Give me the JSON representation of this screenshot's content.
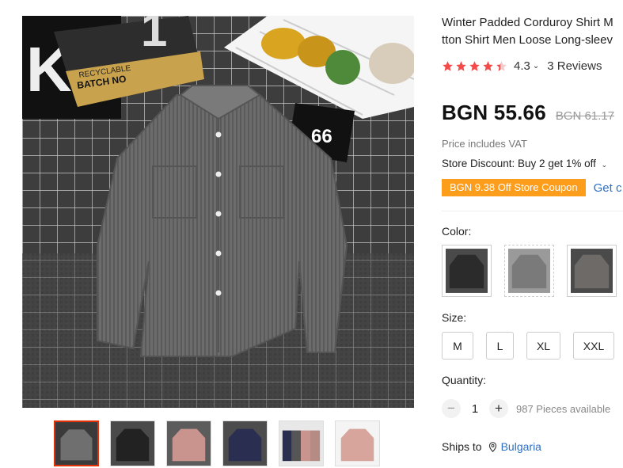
{
  "product": {
    "title_line1": "Winter Padded Corduroy Shirt M",
    "title_line2": "tton Shirt Men Loose Long-sleev",
    "rating": "4.3",
    "rating_stars": 4.3,
    "reviews": "3 Reviews"
  },
  "price": {
    "current": "BGN 55.66",
    "original": "BGN 61.17",
    "vat_note": "Price includes VAT"
  },
  "discount": {
    "store_discount": "Store Discount: Buy 2 get 1% off",
    "coupon": "BGN 9.38 Off Store Coupon",
    "get_coupon": "Get c"
  },
  "options": {
    "color_label": "Color:",
    "colors": [
      {
        "name": "black",
        "swatch": "#2b2b2b"
      },
      {
        "name": "gray",
        "swatch": "#7a7a7a"
      },
      {
        "name": "dark-gray",
        "swatch": "#5e5e5e"
      }
    ],
    "size_label": "Size:",
    "sizes": [
      "M",
      "L",
      "XL",
      "XXL"
    ],
    "quantity_label": "Quantity:",
    "quantity": "1",
    "minus": "−",
    "plus": "+",
    "available": "987 Pieces available"
  },
  "shipping": {
    "label": "Ships to",
    "country": "Bulgaria"
  },
  "gallery": {
    "thumbnails": [
      {
        "name": "gray",
        "color": "#6f6f6f",
        "bg": "#3a3a3a"
      },
      {
        "name": "black",
        "color": "#222222",
        "bg": "#4a4a4a"
      },
      {
        "name": "pink",
        "color": "#c9948e",
        "bg": "#5c5c5c"
      },
      {
        "name": "navy",
        "color": "#2a2f52",
        "bg": "#4c4c4c"
      },
      {
        "name": "multi",
        "color": "#b68b84",
        "bg": "#e8e8e8"
      },
      {
        "name": "pink-white",
        "color": "#d7a59c",
        "bg": "#f4f4f4"
      }
    ]
  },
  "image_text": {
    "sign_66": "66",
    "batch": "BATCH NO",
    "recyclable": "RECYCLABLE"
  },
  "colors": {
    "star": "#f44a4a",
    "coupon_bg": "#fd9d1c",
    "link": "#2e6fc4",
    "thumb_active": "#e62e04"
  }
}
